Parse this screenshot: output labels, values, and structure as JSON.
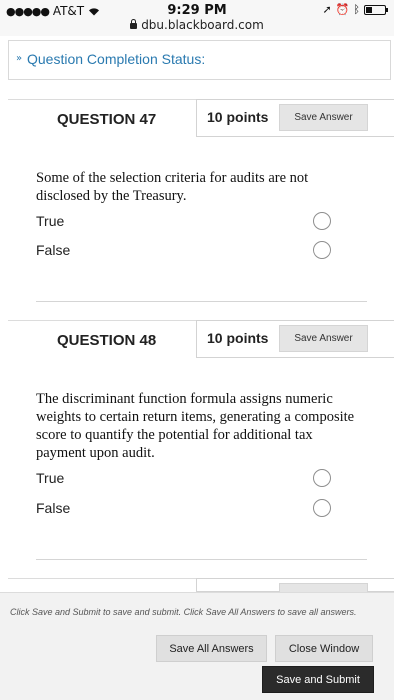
{
  "status_bar": {
    "signal": "●●●●●",
    "carrier": "AT&T",
    "time": "9:29 PM",
    "url": "dbu.blackboard.com"
  },
  "completion_status": {
    "label": "Question Completion Status:"
  },
  "questions": [
    {
      "title": "QUESTION 47",
      "points": "10 points",
      "save_label": "Save Answer",
      "text": "Some of the selection criteria for audits are not disclosed by the Treasury.",
      "options": [
        "True",
        "False"
      ]
    },
    {
      "title": "QUESTION 48",
      "points": "10 points",
      "save_label": "Save Answer",
      "text": "The discriminant function formula assigns numeric weights to certain return items, generating a composite score to quantify the potential for additional tax payment upon audit.",
      "options": [
        "True",
        "False"
      ]
    }
  ],
  "footer": {
    "note": "Click Save and Submit to save and submit. Click Save All Answers to save all answers.",
    "save_all_label": "Save All Answers",
    "close_label": "Close Window",
    "submit_label": "Save and Submit"
  }
}
